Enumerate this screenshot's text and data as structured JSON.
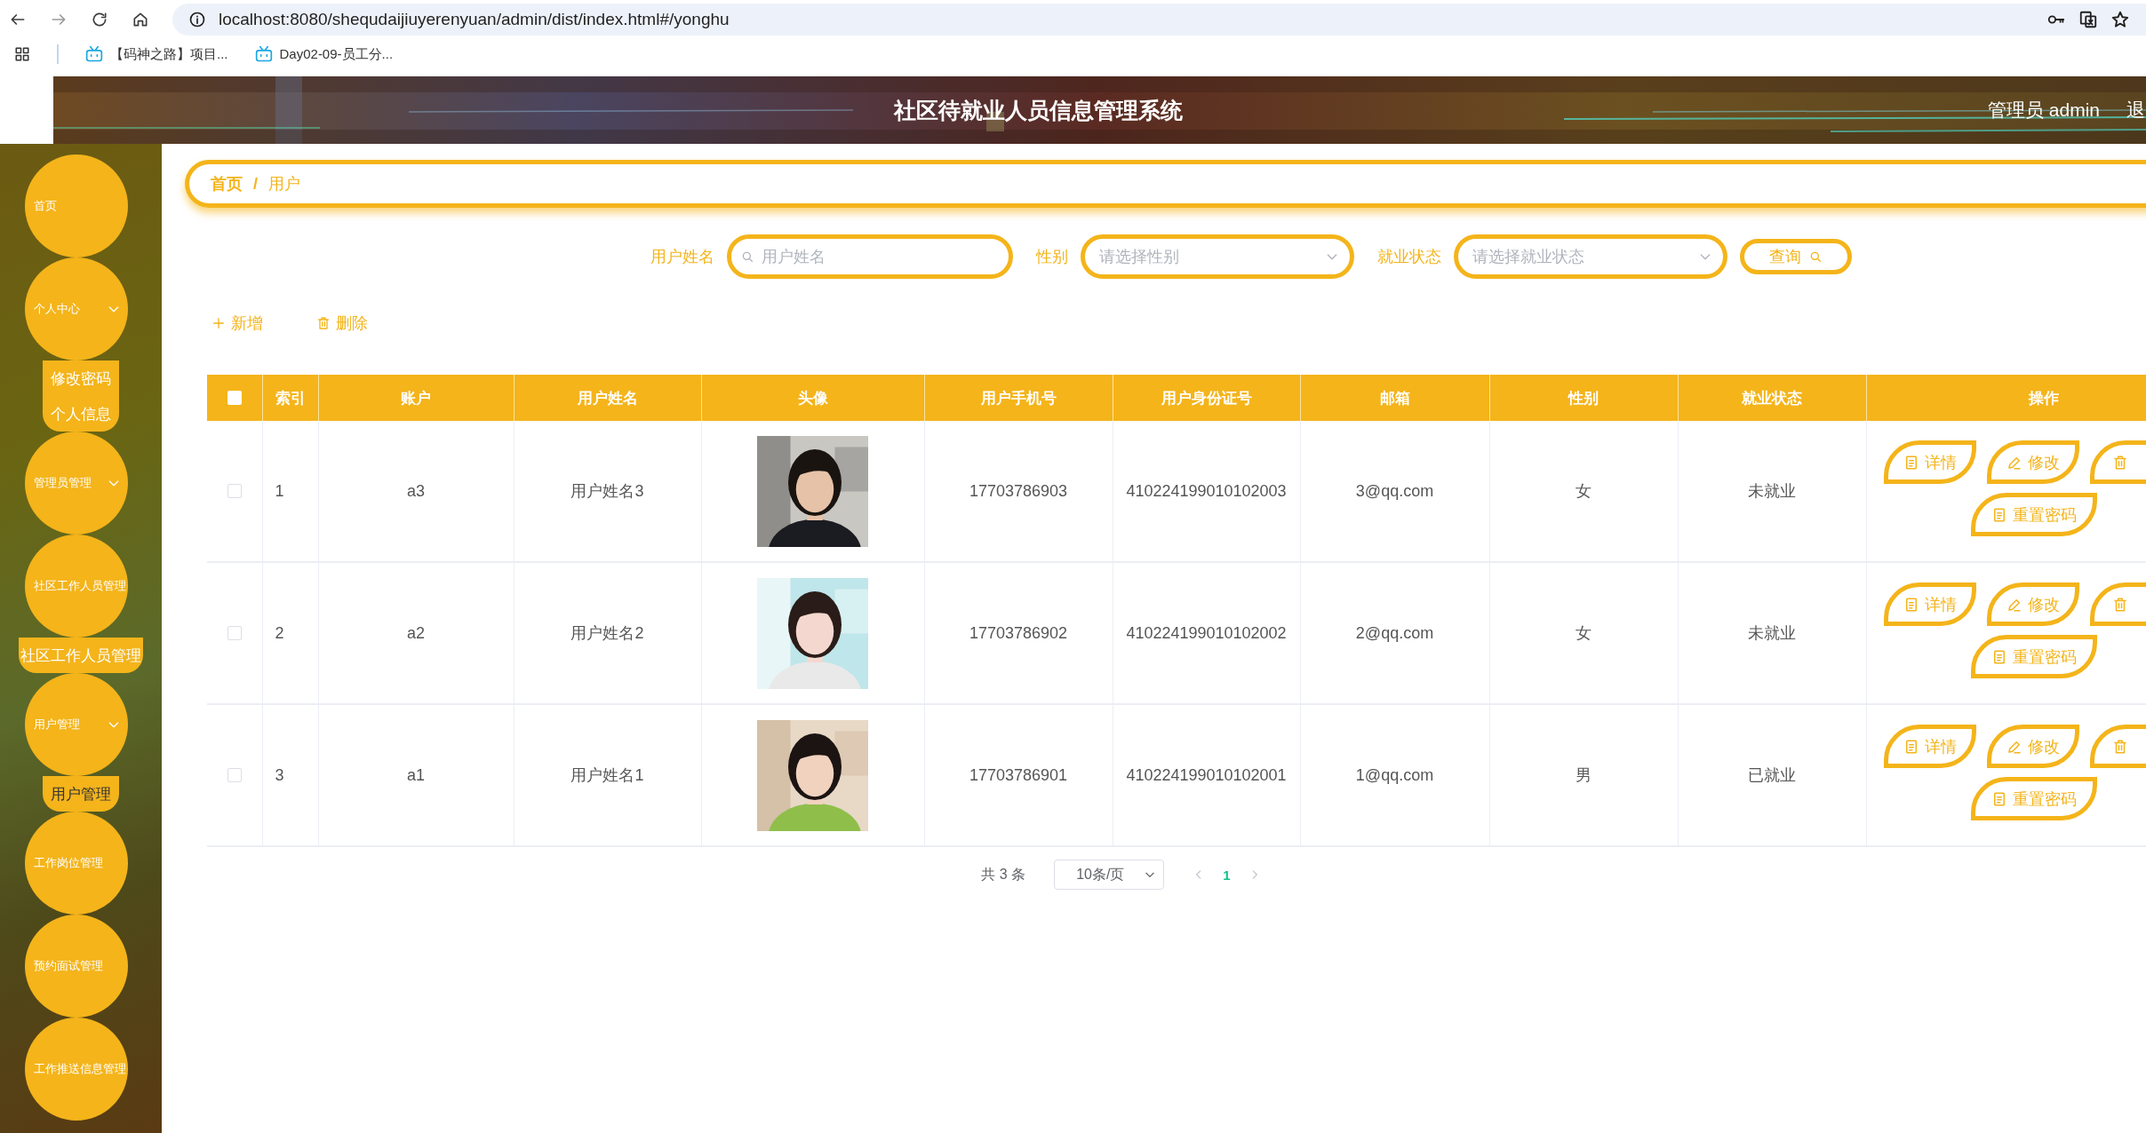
{
  "browser": {
    "url": "localhost:8080/shequdaijiuyerenyuan/admin/dist/index.html#/yonghu",
    "bookmarks": [
      {
        "label": "【码神之路】项目..."
      },
      {
        "label": "Day02-09-员工分..."
      }
    ]
  },
  "header": {
    "title": "社区待就业人员信息管理系统",
    "user": "管理员 admin",
    "logout": "退"
  },
  "sidebar": {
    "items": [
      {
        "label": "首页"
      },
      {
        "label": "个人中心",
        "arrow": true,
        "children": [
          {
            "label": "修改密码",
            "selected": false
          },
          {
            "label": "个人信息",
            "selected": false
          }
        ]
      },
      {
        "label": "管理员管理",
        "arrow": true
      },
      {
        "label": "社区工作人员管理",
        "children": [
          {
            "label": "社区工作人员管理",
            "selected": false
          }
        ]
      },
      {
        "label": "用户管理",
        "arrow": true,
        "children": [
          {
            "label": "用户管理",
            "selected": true
          }
        ]
      },
      {
        "label": "工作岗位管理"
      },
      {
        "label": "预约面试管理"
      },
      {
        "label": "工作推送信息管理"
      }
    ]
  },
  "breadcrumb": {
    "items": [
      "首页",
      "用户"
    ],
    "separator": "/"
  },
  "search": {
    "fields": [
      {
        "kind": "input",
        "label": "用户姓名",
        "placeholder": "用户姓名"
      },
      {
        "kind": "select",
        "label": "性别",
        "placeholder": "请选择性别"
      },
      {
        "kind": "select",
        "label": "就业状态",
        "placeholder": "请选择就业状态"
      }
    ],
    "button": "查询"
  },
  "toolbar": [
    {
      "kind": "add",
      "label": "新增"
    },
    {
      "kind": "delete",
      "label": "删除"
    }
  ],
  "table": {
    "select_all": {
      "checked": false
    },
    "columns": [
      "索引",
      "账户",
      "用户姓名",
      "头像",
      "用户手机号",
      "用户身份证号",
      "邮箱",
      "性别",
      "就业状态",
      "操作"
    ],
    "rows": [
      {
        "checked": false,
        "index": "1",
        "account": "a3",
        "name": "用户姓名3",
        "phone": "17703786903",
        "id_number": "410224199010102003",
        "email": "3@qq.com",
        "gender": "女",
        "status": "未就业",
        "actions": [
          {
            "kind": "detail",
            "label": "详情"
          },
          {
            "kind": "edit",
            "label": "修改"
          },
          {
            "kind": "delete"
          },
          {
            "kind": "reset",
            "label": "重置密码"
          }
        ]
      },
      {
        "checked": false,
        "index": "2",
        "account": "a2",
        "name": "用户姓名2",
        "phone": "17703786902",
        "id_number": "410224199010102002",
        "email": "2@qq.com",
        "gender": "女",
        "status": "未就业",
        "actions": [
          {
            "kind": "detail",
            "label": "详情"
          },
          {
            "kind": "edit",
            "label": "修改"
          },
          {
            "kind": "delete"
          },
          {
            "kind": "reset",
            "label": "重置密码"
          }
        ]
      },
      {
        "checked": false,
        "index": "3",
        "account": "a1",
        "name": "用户姓名1",
        "phone": "17703786901",
        "id_number": "410224199010102001",
        "email": "1@qq.com",
        "gender": "男",
        "status": "已就业",
        "actions": [
          {
            "kind": "detail",
            "label": "详情"
          },
          {
            "kind": "edit",
            "label": "修改"
          },
          {
            "kind": "delete"
          },
          {
            "kind": "reset",
            "label": "重置密码"
          }
        ]
      }
    ]
  },
  "pagination": {
    "total": "共 3 条",
    "page_size": "10条/页",
    "pages": [
      {
        "label": "1",
        "selected": true
      }
    ]
  }
}
